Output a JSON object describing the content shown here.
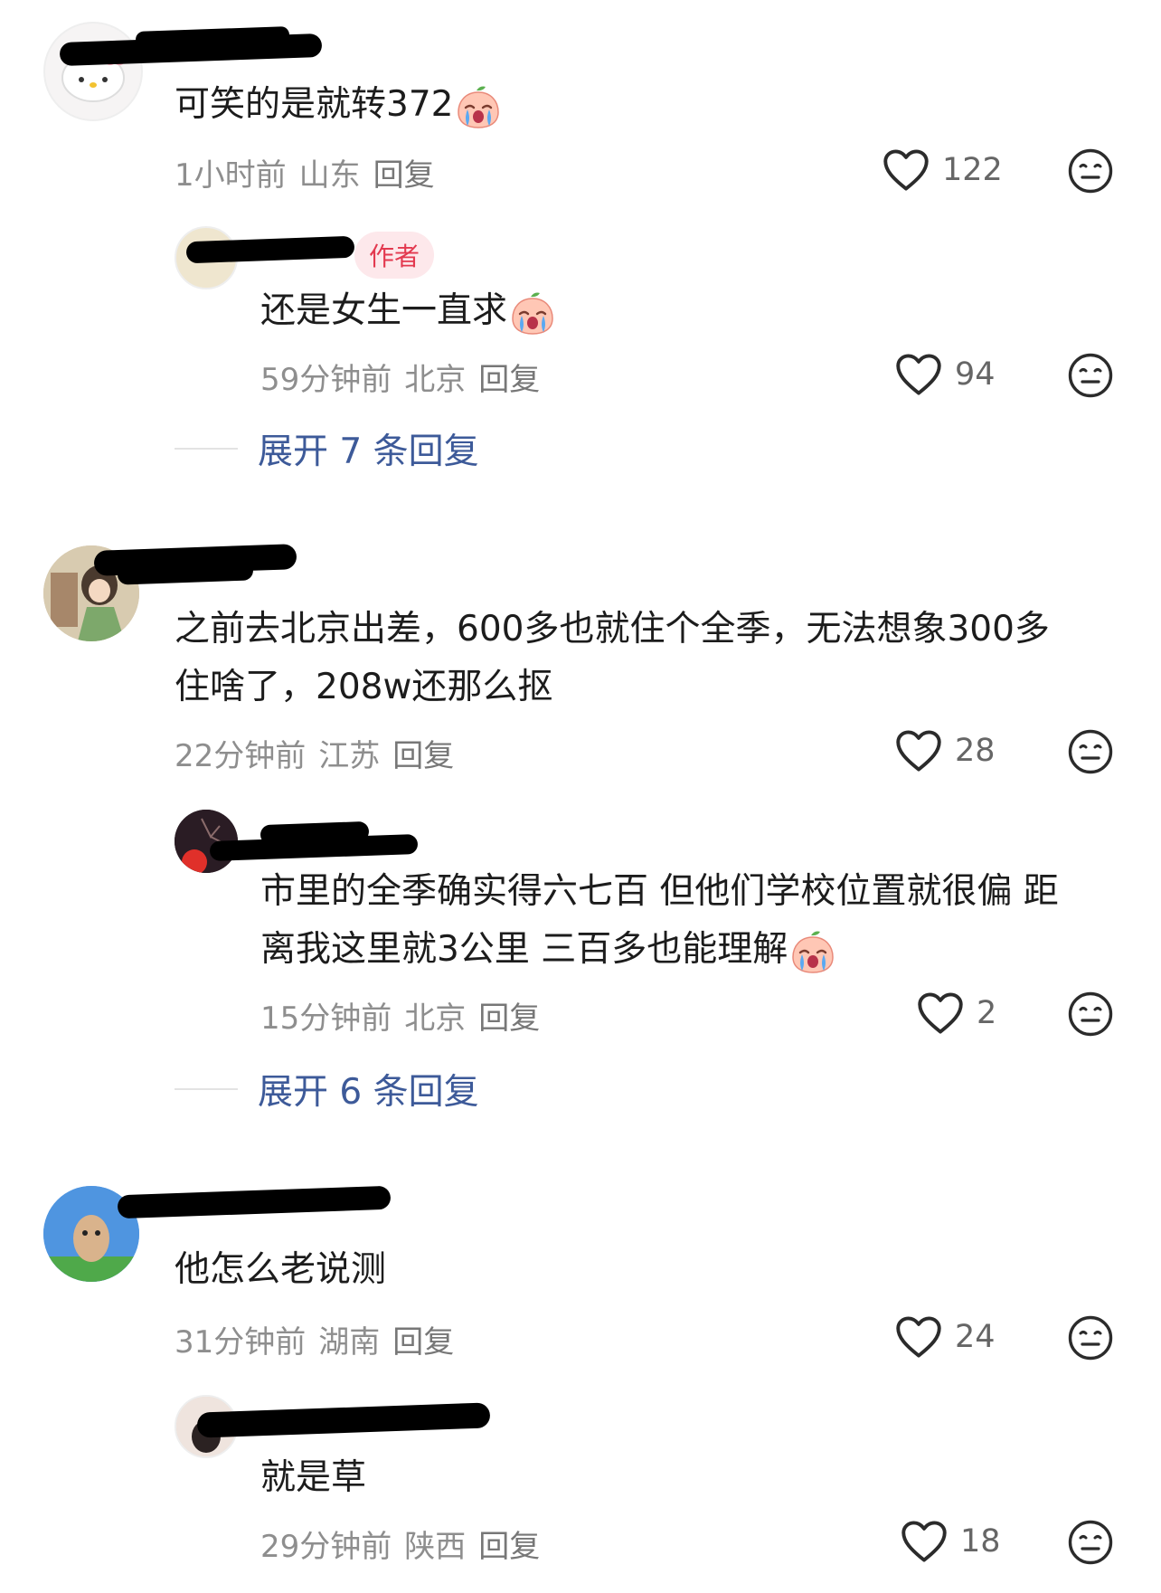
{
  "comments": [
    {
      "text": "可笑的是就转372",
      "time": "1小时前",
      "location": "山东",
      "reply_label": "回复",
      "likes": "122",
      "replies": [
        {
          "author_badge": "作者",
          "text": "还是女生一直求",
          "time": "59分钟前",
          "location": "北京",
          "reply_label": "回复",
          "likes": "94"
        }
      ],
      "expand_label": "展开 7 条回复"
    },
    {
      "text_line1": "之前去北京出差，600多也就住个全季，无法想象300多",
      "text_line2": "住啥了，208w还那么抠",
      "time": "22分钟前",
      "location": "江苏",
      "reply_label": "回复",
      "likes": "28",
      "replies": [
        {
          "text_line1": "市里的全季确实得六七百 但他们学校位置就很偏 距",
          "text_line2": "离我这里就3公里 三百多也能理解",
          "time": "15分钟前",
          "location": "北京",
          "reply_label": "回复",
          "likes": "2"
        }
      ],
      "expand_label": "展开 6 条回复"
    },
    {
      "text": "他怎么老说测",
      "time": "31分钟前",
      "location": "湖南",
      "reply_label": "回复",
      "likes": "24",
      "replies": [
        {
          "text": "就是草",
          "time": "29分钟前",
          "location": "陕西",
          "reply_label": "回复",
          "likes": "18"
        }
      ]
    }
  ],
  "colors": {
    "link": "#3d5a99",
    "meta": "#8e8e8e",
    "author_tag_bg": "#fde8eb",
    "author_tag_text": "#e3394f"
  },
  "icons": {
    "like": "heart-outline-icon",
    "dislike": "meh-face-icon",
    "emoji": "crying-peach-emoji"
  }
}
